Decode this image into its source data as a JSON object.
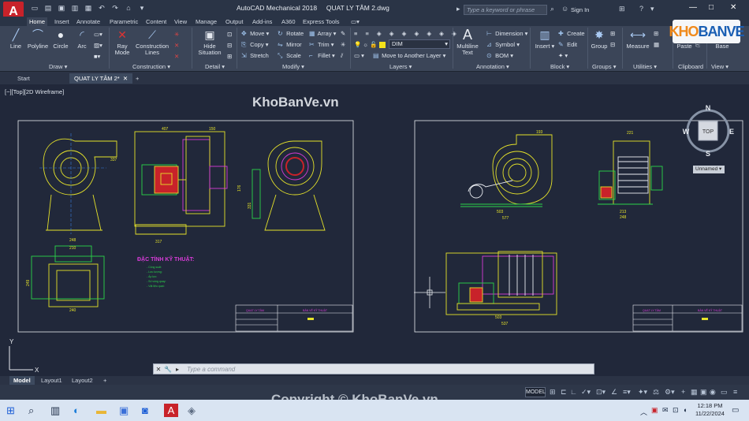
{
  "titlebar": {
    "app_name": "AutoCAD Mechanical 2018",
    "file_name": "QUAT LY TÂM 2.dwg",
    "search_placeholder": "Type a keyword or phrase",
    "signin": "Sign In",
    "logo_letter": "A"
  },
  "ribbon_tabs": [
    "Home",
    "Insert",
    "Annotate",
    "Parametric",
    "Content",
    "View",
    "Manage",
    "Output",
    "Add-ins",
    "A360",
    "Express Tools"
  ],
  "panels": {
    "draw": {
      "title": "Draw",
      "tools": [
        "Line",
        "Polyline",
        "Circle",
        "Arc"
      ]
    },
    "construction": {
      "title": "Construction",
      "tools": [
        "Ray Mode",
        "Construction Lines"
      ]
    },
    "detail": {
      "title": "Detail",
      "tools": [
        "Hide Situation"
      ]
    },
    "modify": {
      "title": "Modify",
      "tools": [
        "Move",
        "Rotate",
        "Array",
        "Copy",
        "Mirror",
        "Trim",
        "Stretch",
        "Scale",
        "Fillet"
      ]
    },
    "layers": {
      "title": "Layers",
      "current_layer": "DIM",
      "move_label": "Move to Another Layer"
    },
    "annotation": {
      "title": "Annotation",
      "tools": [
        "Multiline Text",
        "Dimension",
        "Symbol",
        "BOM"
      ]
    },
    "block": {
      "title": "Block",
      "tools": [
        "Insert",
        "Create",
        "Edit"
      ]
    },
    "groups": {
      "title": "Groups",
      "tools": [
        "Group"
      ]
    },
    "utilities": {
      "title": "Utilities",
      "tools": [
        "Measure"
      ]
    },
    "clipboard": {
      "title": "Clipboard",
      "tools": [
        "Paste"
      ]
    },
    "view": {
      "title": "View",
      "tools": [
        "Base"
      ]
    }
  },
  "file_tabs": [
    "Start",
    "QUAT LY TÂM 2*"
  ],
  "viewport_label": "[−][Top][2D Wireframe]",
  "viewcube": {
    "n": "N",
    "s": "S",
    "e": "E",
    "w": "W",
    "face": "TOP",
    "ucs": "Unnamed"
  },
  "drawing": {
    "tech_title": "ĐẶC TÍNH KỸ THUẬT:",
    "tech_lines": [
      "- Công suất:",
      "- Lưu lượng:",
      "- Áp lực:",
      "- Số vòng quay:",
      "- Vật liệu quạt:"
    ],
    "title_block_left": "QUẠT LY TÂM",
    "title_block_right": "BẢN VẼ KỸ THUẬT",
    "dims_left": [
      "407",
      "150",
      "317",
      "176",
      "331",
      "337",
      "248",
      "210",
      "240",
      "249"
    ],
    "dims_right": [
      "193",
      "503",
      "577",
      "221",
      "213",
      "248",
      "503",
      "537"
    ]
  },
  "command_line": {
    "placeholder": "Type a command"
  },
  "layout_tabs": [
    "Model",
    "Layout1",
    "Layout2"
  ],
  "status": {
    "mode": "MODEL"
  },
  "clock": {
    "time": "12:18 PM",
    "date": "11/22/2024"
  },
  "watermark": {
    "top": "KhoBanVe.vn",
    "bottom": "Copyright © KhoBanVe.vn",
    "logo_part1": "KHO",
    "logo_part2": "BANVE"
  },
  "colors": {
    "bg": "#21283a",
    "accent": "#c8222a",
    "ribbon": "#3b4558",
    "line_yellow": "#e5e22a",
    "line_green": "#2bd44a",
    "line_magenta": "#d83cd8"
  }
}
